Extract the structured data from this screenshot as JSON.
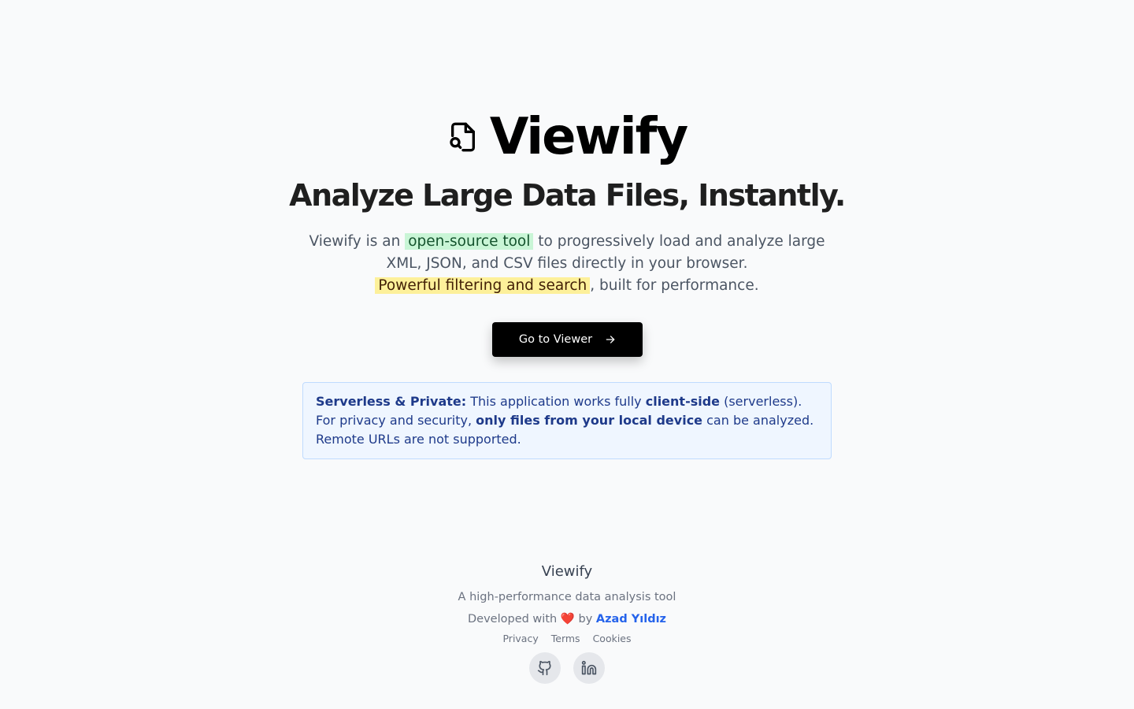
{
  "hero": {
    "brand_name": "Viewify",
    "brand_icon": "file-search-icon",
    "headline": "Analyze Large Data Files, Instantly.",
    "intro_part1": "Viewify is an ",
    "intro_highlight1": "open-source tool",
    "intro_part2": " to progressively load and analyze large XML, JSON, and CSV files directly in your browser.",
    "intro_highlight2": "Powerful filtering and search",
    "intro_part3": ", built for performance.",
    "cta_label": "Go to Viewer",
    "cta_icon": "arrow-right-icon"
  },
  "notice": {
    "title": "Serverless & Private:",
    "text1": " This application works fully ",
    "bold1": "client-side",
    "text2": " (serverless). For privacy and security, ",
    "bold2": "only files from your local device",
    "text3": " can be analyzed. Remote URLs are not supported."
  },
  "footer": {
    "title": "Viewify",
    "tagline": "A high-performance data analysis tool",
    "developed_prefix": "Developed with",
    "heart": "❤️",
    "developed_by": "by",
    "author": "Azad Yıldız",
    "links": [
      "Privacy",
      "Terms",
      "Cookies"
    ],
    "socials": [
      "github-icon",
      "linkedin-icon"
    ]
  },
  "colors": {
    "background": "#f9fafb",
    "cta_background": "#000000",
    "highlight_green": "#c9f5d6",
    "highlight_yellow": "#fdf09a",
    "notice_background": "#eff6ff",
    "notice_border": "#bfdbfe",
    "notice_text": "#1e3a8a",
    "author_link": "#2563eb"
  }
}
